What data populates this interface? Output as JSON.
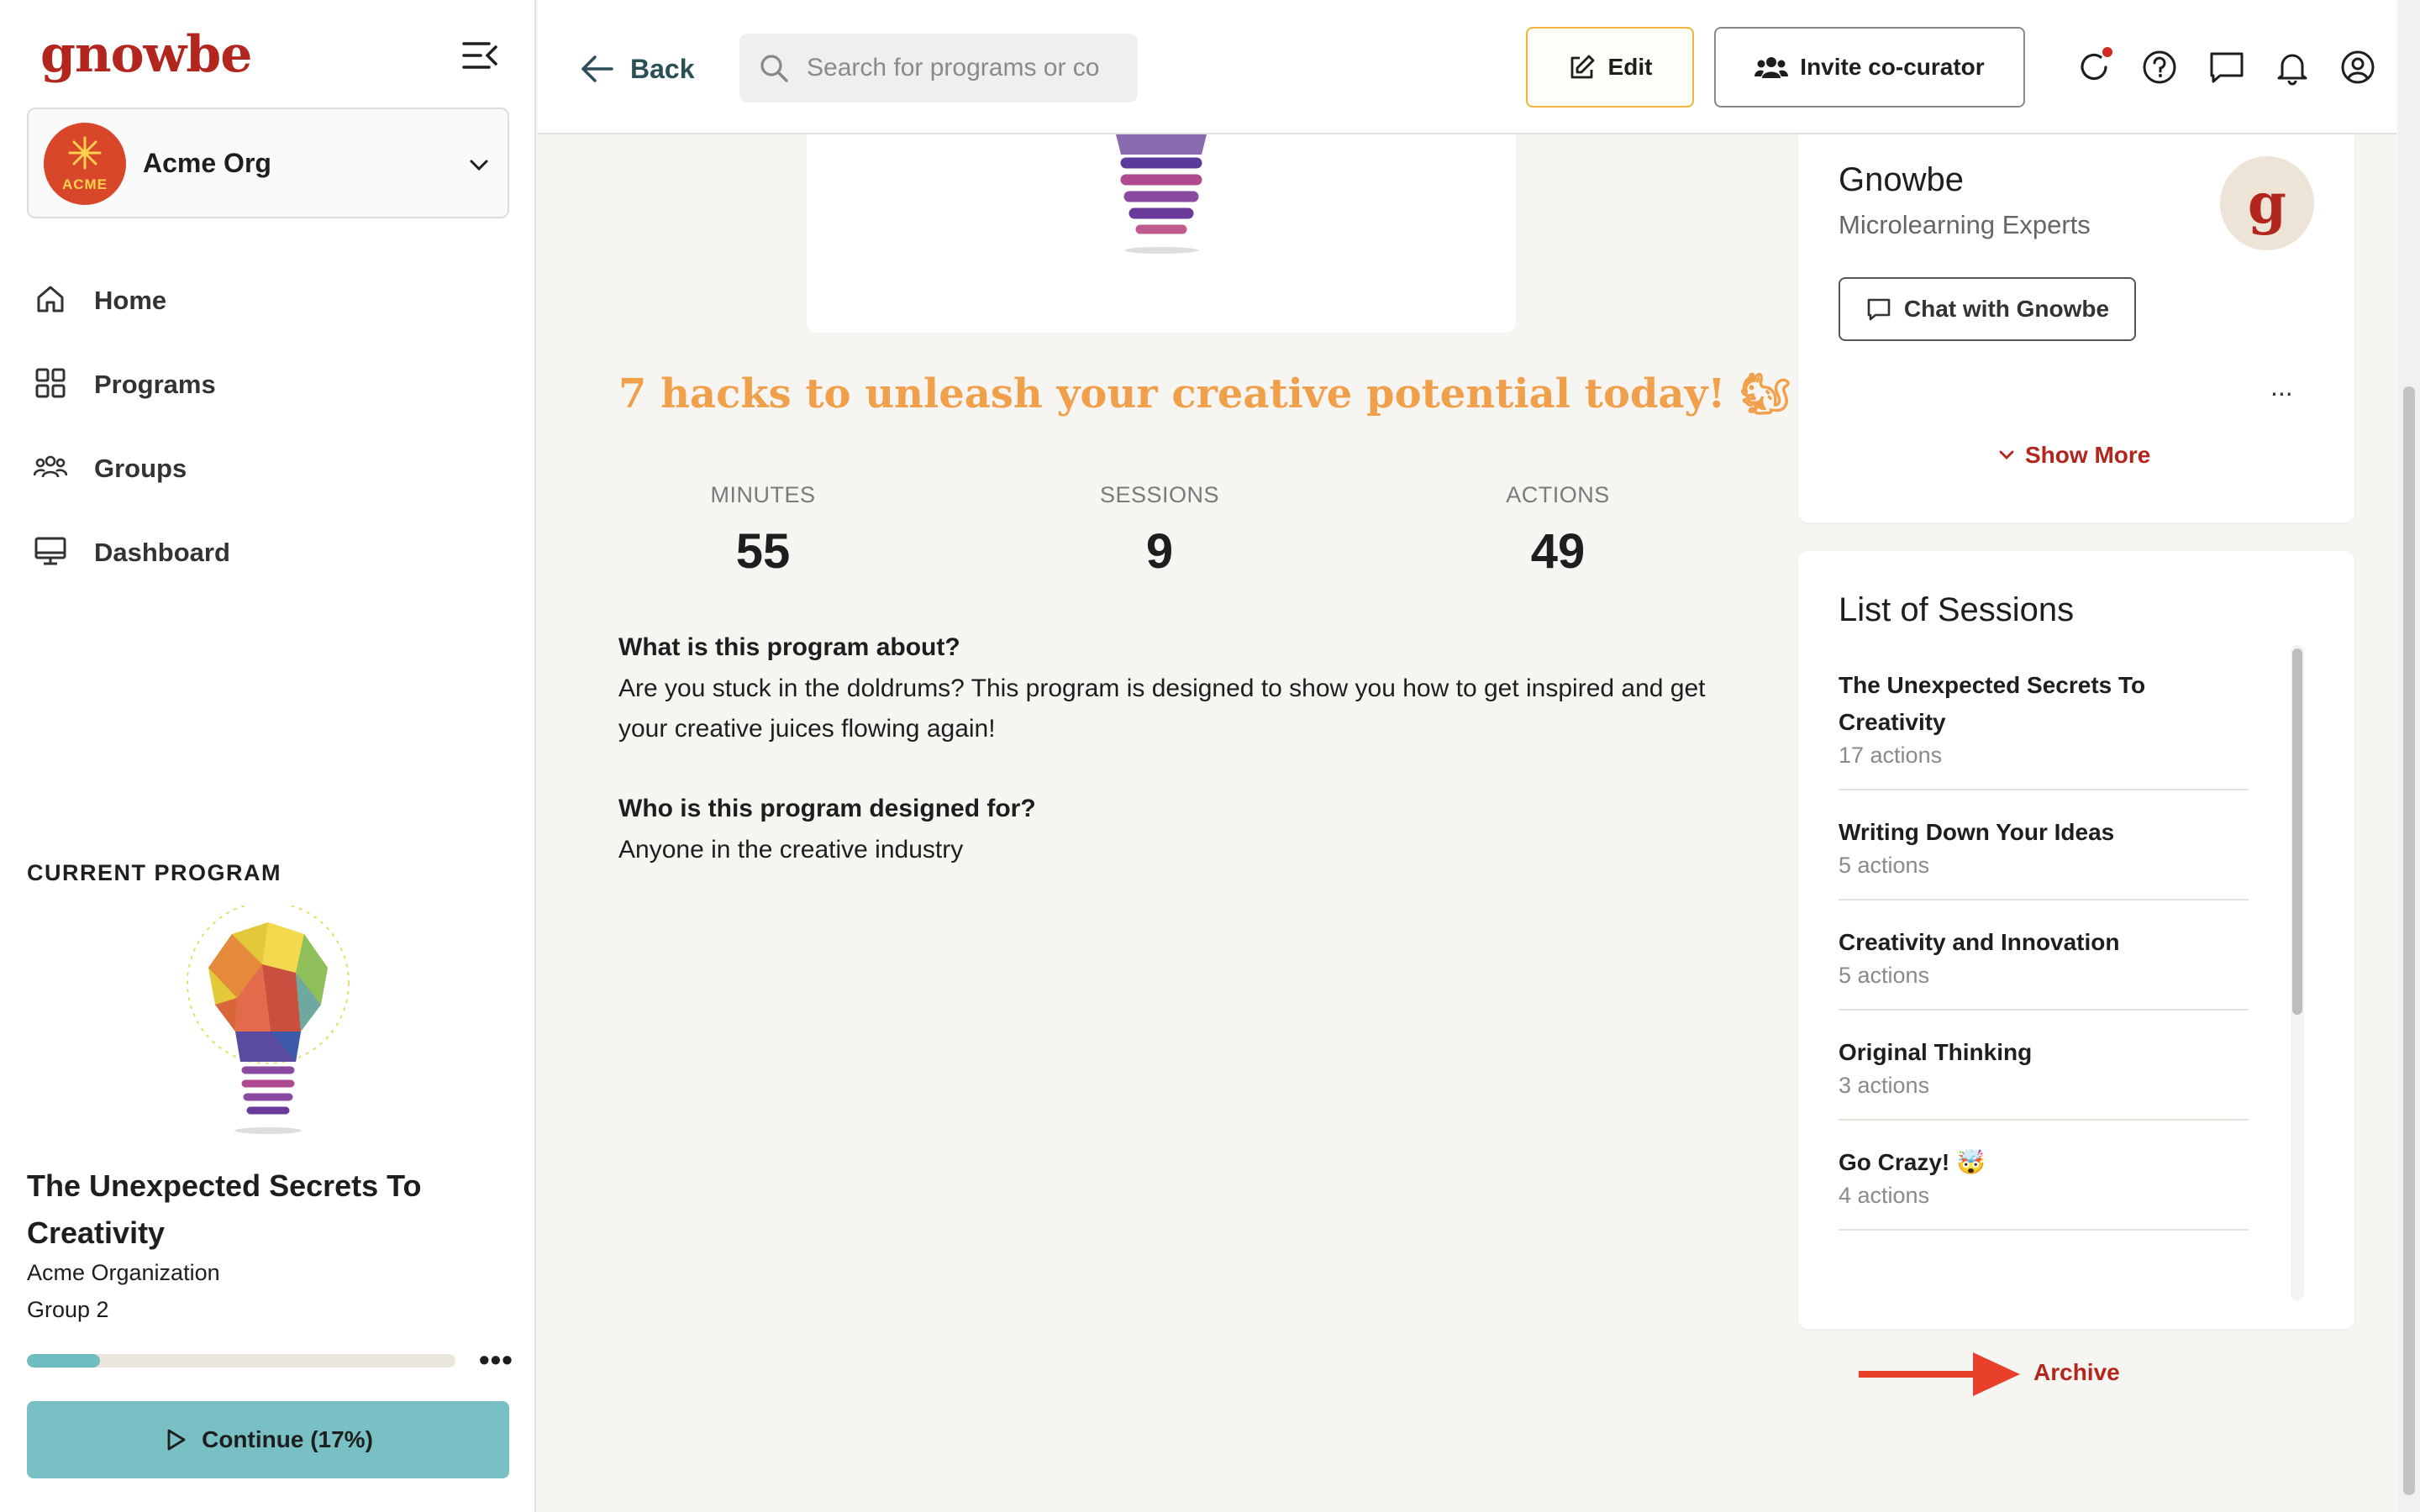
{
  "sidebar": {
    "logo": "gnowbe",
    "org": {
      "name": "Acme Org",
      "avatar_text": "ACME"
    },
    "nav": [
      {
        "label": "Home",
        "icon": "home-icon"
      },
      {
        "label": "Programs",
        "icon": "grid-icon"
      },
      {
        "label": "Groups",
        "icon": "users-icon"
      },
      {
        "label": "Dashboard",
        "icon": "monitor-icon"
      }
    ],
    "current_program": {
      "heading": "CURRENT PROGRAM",
      "title": "The Unexpected Secrets To Creativity",
      "org": "Acme Organization",
      "group": "Group 2",
      "progress": 0.17,
      "continue_label": "Continue (17%)"
    }
  },
  "topbar": {
    "back_label": "Back",
    "search_placeholder": "Search for programs or co",
    "edit_label": "Edit",
    "invite_label": "Invite co-curator",
    "icons": [
      "refresh-icon",
      "help-icon",
      "chat-icon",
      "bell-icon",
      "user-icon"
    ]
  },
  "program": {
    "title": "7 hacks to unleash your creative potential today! 🐿",
    "stats": [
      {
        "label": "MINUTES",
        "value": "55"
      },
      {
        "label": "SESSIONS",
        "value": "9"
      },
      {
        "label": "ACTIONS",
        "value": "49"
      }
    ],
    "about_heading": "What is this program about?",
    "about_body": "Are you stuck in the doldrums? This program is designed to show you how to get inspired and get your creative juices flowing again!",
    "audience_heading": "Who is this program designed for?",
    "audience_body": "Anyone in the creative industry"
  },
  "author": {
    "name": "Gnowbe",
    "role": "Microlearning Experts",
    "avatar_letter": "g",
    "chat_label": "Chat with Gnowbe",
    "dots": "...",
    "show_more_label": "Show More"
  },
  "sessions": {
    "title": "List of Sessions",
    "items": [
      {
        "title": "The Unexpected Secrets To Creativity",
        "count": "17 actions"
      },
      {
        "title": "Writing Down Your Ideas",
        "count": "5 actions"
      },
      {
        "title": "Creativity and Innovation",
        "count": "5 actions"
      },
      {
        "title": "Original Thinking",
        "count": "3 actions"
      },
      {
        "title": "Go Crazy! 🤯",
        "count": "4 actions"
      }
    ]
  },
  "archive_label": "Archive",
  "colors": {
    "brand": "#b3261e",
    "accent_orange": "#f0a04b",
    "teal": "#78c0c4",
    "arrow": "#e8402a"
  }
}
